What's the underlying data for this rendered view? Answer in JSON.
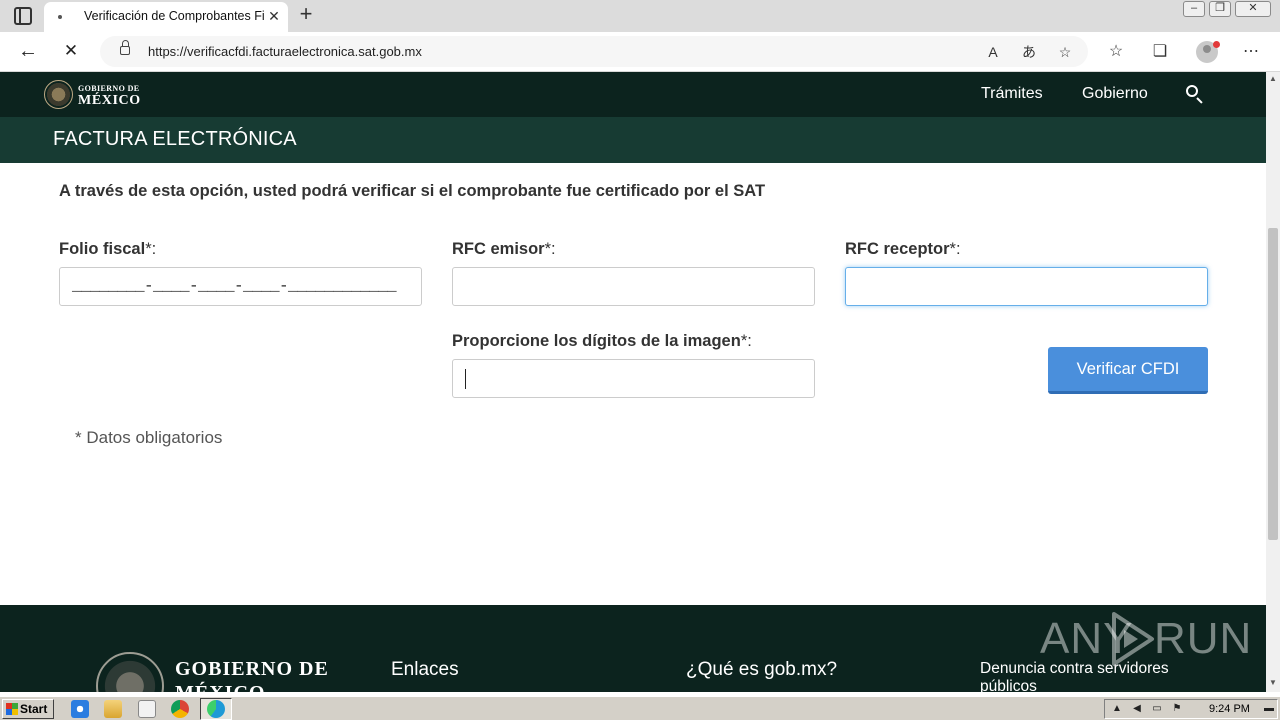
{
  "browser": {
    "tab_title": "Verificación de Comprobantes Fiscales Digitales por Internet",
    "tab_close": "✕",
    "new_tab": "+",
    "url_host": "https://verificacfdi.facturaelectronica.sat.gob.mx",
    "window_controls": [
      "–",
      "❐",
      "✕"
    ]
  },
  "header": {
    "logo_top": "GOBIERNO DE",
    "logo_main": "MÉXICO",
    "nav_items": [
      "Trámites",
      "Gobierno"
    ]
  },
  "subheader": {
    "title": "FACTURA ELECTRÓNICA"
  },
  "form": {
    "intro": "A través de esta opción, usted podrá verificar si el comprobante fue certificado por el SAT",
    "folio_label": "Folio fiscal",
    "rfc_emisor_label": "RFC emisor",
    "rfc_receptor_label": "RFC receptor",
    "captcha_label": "Proporcione los dígitos de la imagen",
    "required_mark": "*:",
    "folio_mask": "________-____-____-____-____________",
    "verify_button": "Verificar CFDI",
    "required_note": "* Datos obligatorios"
  },
  "footer": {
    "logo_line1": "GOBIERNO DE",
    "logo_line2": "MÉXICO",
    "links_heading": "Enlaces",
    "about_heading": "¿Qué es gob.mx?",
    "complaint_heading": "Denuncia contra servidores públicos"
  },
  "watermark": {
    "left": "ANY",
    "right": "RUN"
  },
  "taskbar": {
    "start_label": "Start",
    "clock": "9:24 PM"
  },
  "colors": {
    "nav_bg": "#0c231e",
    "subheader_bg": "#173b33",
    "button_bg": "#4a8fdc",
    "focus_border": "#66afe9"
  }
}
